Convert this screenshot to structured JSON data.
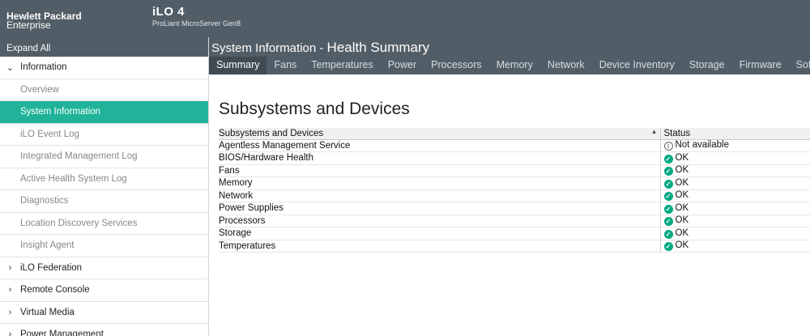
{
  "brand": {
    "line1": "Hewlett Packard",
    "line2": "Enterprise"
  },
  "product": {
    "name": "iLO 4",
    "model": "ProLiant MicroServer Gen8"
  },
  "sidebar": {
    "expand_all": "Expand All",
    "items": [
      {
        "label": "Information",
        "kind": "top",
        "chevron": "⌄"
      },
      {
        "label": "Overview",
        "kind": "sub"
      },
      {
        "label": "System Information",
        "kind": "sub",
        "active": true
      },
      {
        "label": "iLO Event Log",
        "kind": "sub"
      },
      {
        "label": "Integrated Management Log",
        "kind": "sub"
      },
      {
        "label": "Active Health System Log",
        "kind": "sub"
      },
      {
        "label": "Diagnostics",
        "kind": "sub"
      },
      {
        "label": "Location Discovery Services",
        "kind": "sub"
      },
      {
        "label": "Insight Agent",
        "kind": "sub"
      },
      {
        "label": "iLO Federation",
        "kind": "top",
        "chevron": "›"
      },
      {
        "label": "Remote Console",
        "kind": "top",
        "chevron": "›"
      },
      {
        "label": "Virtual Media",
        "kind": "top",
        "chevron": "›"
      },
      {
        "label": "Power Management",
        "kind": "top",
        "chevron": "›"
      }
    ]
  },
  "header": {
    "title_prefix": "System Information - ",
    "title_main": "Health Summary"
  },
  "tabs": [
    "Summary",
    "Fans",
    "Temperatures",
    "Power",
    "Processors",
    "Memory",
    "Network",
    "Device Inventory",
    "Storage",
    "Firmware",
    "Software"
  ],
  "active_tab": "Summary",
  "content": {
    "title": "Subsystems and Devices",
    "columns": [
      "Subsystems and Devices",
      "Status"
    ],
    "rows": [
      {
        "name": "Agentless Management Service",
        "status": "Not available",
        "icon": "info-icon"
      },
      {
        "name": "BIOS/Hardware Health",
        "status": "OK",
        "icon": "ok-check-icon"
      },
      {
        "name": "Fans",
        "status": "OK",
        "icon": "ok-check-icon"
      },
      {
        "name": "Memory",
        "status": "OK",
        "icon": "ok-check-icon"
      },
      {
        "name": "Network",
        "status": "OK",
        "icon": "ok-check-icon"
      },
      {
        "name": "Power Supplies",
        "status": "OK",
        "icon": "ok-check-icon"
      },
      {
        "name": "Processors",
        "status": "OK",
        "icon": "ok-check-icon"
      },
      {
        "name": "Storage",
        "status": "OK",
        "icon": "ok-check-icon"
      },
      {
        "name": "Temperatures",
        "status": "OK",
        "icon": "ok-check-icon"
      }
    ]
  },
  "colors": {
    "header_bg": "#525e67",
    "accent": "#01a982",
    "active_nav": "#20b39a"
  }
}
